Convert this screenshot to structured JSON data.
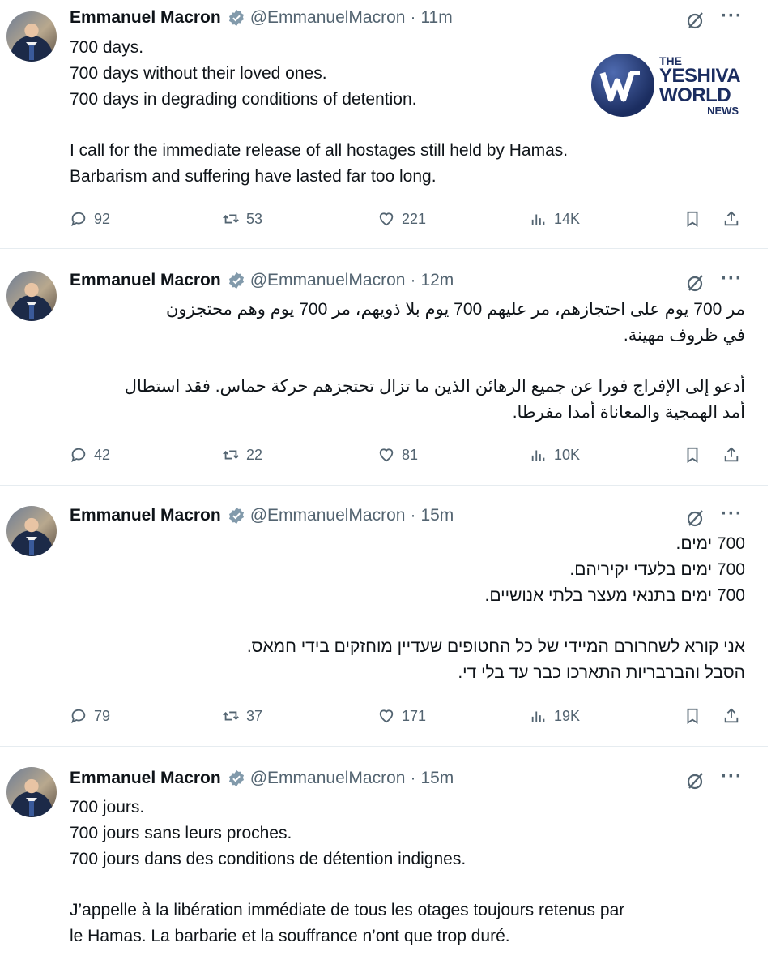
{
  "tweets": [
    {
      "name": "Emmanuel Macron",
      "handle": "@EmmanuelMacron",
      "time": "11m",
      "lines": [
        "700 days.",
        "700 days without their loved ones.",
        "700 days in degrading conditions of detention.",
        "",
        "I call for the immediate release of all hostages still held by Hamas.",
        "Barbarism and suffering have lasted far too long."
      ],
      "replies": "92",
      "reposts": "53",
      "likes": "221",
      "views": "14K"
    },
    {
      "name": "Emmanuel Macron",
      "handle": "@EmmanuelMacron",
      "time": "12m",
      "lines": [
        "مر 700 يوم على احتجازهم، مر عليهم 700 يوم بلا ذويهم، مر 700 يوم وهم محتجزون",
        "في ظروف مهينة.",
        "",
        "أدعو إلى الإفراج فورا عن جميع الرهائن الذين ما تزال تحتجزهم حركة حماس. فقد استطال",
        "أمد الهمجية والمعاناة أمدا مفرطا."
      ],
      "replies": "42",
      "reposts": "22",
      "likes": "81",
      "views": "10K"
    },
    {
      "name": "Emmanuel Macron",
      "handle": "@EmmanuelMacron",
      "time": "15m",
      "lines": [
        "700 ימים.",
        "700 ימים בלעדי יקיריהם.",
        "700 ימים בתנאי מעצר בלתי אנושיים.",
        "",
        "אני קורא לשחרורם המיידי של כל החטופים שעדיין מוחזקים בידי חמאס.",
        "הסבל והברבריות התארכו כבר עד בלי די."
      ],
      "replies": "79",
      "reposts": "37",
      "likes": "171",
      "views": "19K"
    },
    {
      "name": "Emmanuel Macron",
      "handle": "@EmmanuelMacron",
      "time": "15m",
      "lines": [
        "700 jours.",
        "700 jours sans leurs proches.",
        "700 jours dans des conditions de détention indignes.",
        "",
        "J’appelle à la libération immédiate de tous les otages toujours retenus par",
        "le Hamas. La barbarie et la souffrance n’ont que trop duré."
      ]
    }
  ],
  "watermark": {
    "the": "THE",
    "yeshiva": "YESHIVA",
    "world": "WORLD",
    "news": "NEWS"
  },
  "icons": [
    "verified-badge-icon",
    "grok-icon",
    "more-icon",
    "reply-icon",
    "repost-icon",
    "like-icon",
    "views-icon",
    "bookmark-icon",
    "share-icon"
  ],
  "colors": {
    "text": "#0f1419",
    "muted": "#536471",
    "divider": "#e6ecf0",
    "verified": "#829aab"
  }
}
